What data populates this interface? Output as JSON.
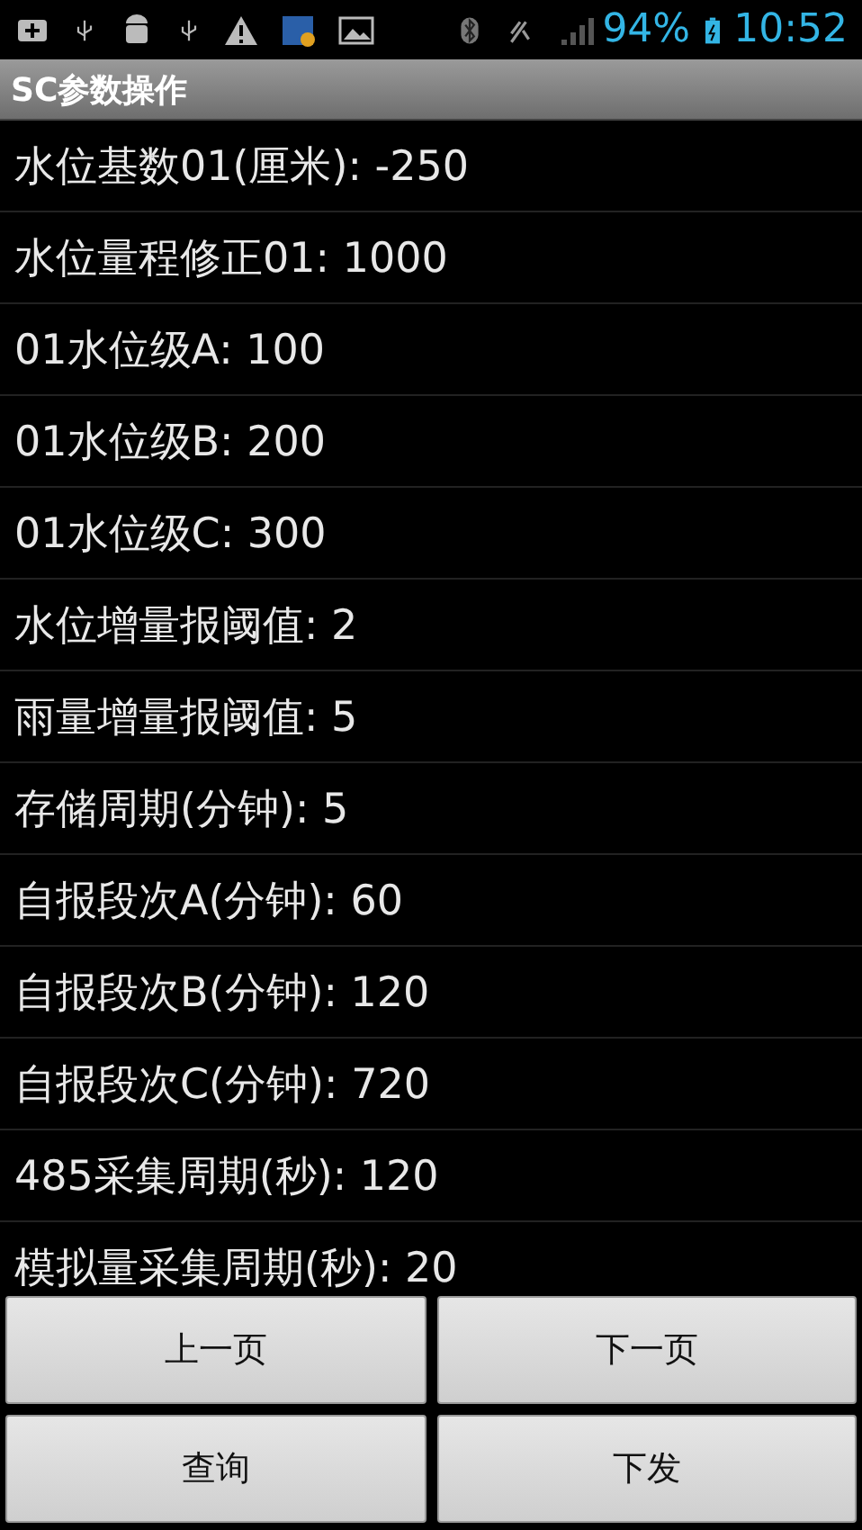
{
  "status_bar": {
    "battery": "94%",
    "time": "10:52"
  },
  "title_bar": {
    "title": "SC参数操作"
  },
  "params": [
    {
      "label": "水位基数01(厘米): -250"
    },
    {
      "label": "水位量程修正01: 1000"
    },
    {
      "label": "01水位级A: 100"
    },
    {
      "label": "01水位级B: 200"
    },
    {
      "label": "01水位级C: 300"
    },
    {
      "label": "水位增量报阈值: 2"
    },
    {
      "label": "雨量增量报阈值: 5"
    },
    {
      "label": "存储周期(分钟): 5"
    },
    {
      "label": "自报段次A(分钟): 60"
    },
    {
      "label": "自报段次B(分钟): 120"
    },
    {
      "label": "自报段次C(分钟): 720"
    },
    {
      "label": "485采集周期(秒): 120"
    },
    {
      "label": "模拟量采集周期(秒): 20"
    }
  ],
  "buttons": [
    "上一页",
    "下一页",
    "查询",
    "下发"
  ]
}
